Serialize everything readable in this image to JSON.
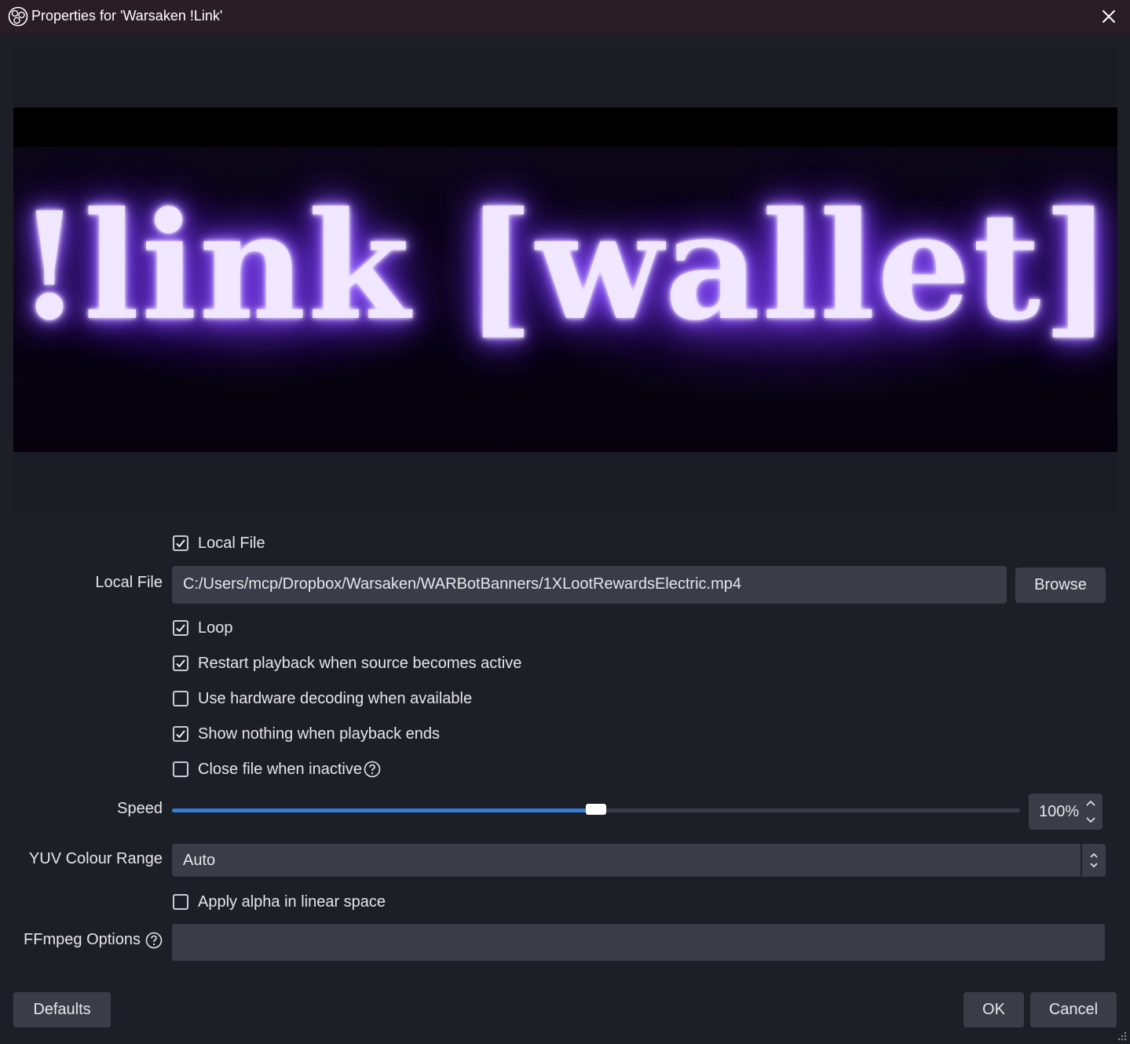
{
  "window": {
    "title": "Properties for 'Warsaken !Link'",
    "app_icon": "obs-icon",
    "close_icon": "close-icon"
  },
  "preview": {
    "video_text": "!link [wallet]"
  },
  "form": {
    "local_file_checkbox": {
      "label": "Local File",
      "checked": true
    },
    "local_file": {
      "label": "Local File",
      "value": "C:/Users/mcp/Dropbox/Warsaken/WARBotBanners/1XLootRewardsElectric.mp4",
      "browse_label": "Browse"
    },
    "checkboxes": [
      {
        "label": "Loop",
        "checked": true
      },
      {
        "label": "Restart playback when source becomes active",
        "checked": true
      },
      {
        "label": "Use hardware decoding when available",
        "checked": false
      },
      {
        "label": "Show nothing when playback ends",
        "checked": true
      },
      {
        "label": "Close file when inactive",
        "checked": false,
        "help_icon": "help-icon"
      }
    ],
    "speed": {
      "label": "Speed",
      "value_text": "100%",
      "fraction": 0.5
    },
    "yuv": {
      "label": "YUV Colour Range",
      "selected": "Auto"
    },
    "alpha_checkbox": {
      "label": "Apply alpha in linear space",
      "checked": false
    },
    "ffmpeg": {
      "label": "FFmpeg Options",
      "value": "",
      "help_icon": "help-icon"
    }
  },
  "footer": {
    "defaults_label": "Defaults",
    "ok_label": "OK",
    "cancel_label": "Cancel"
  },
  "colors": {
    "background": "#1d1f26",
    "titlebar": "#2a1d26",
    "field": "#3a3d48",
    "accent": "#2f7fd6"
  }
}
